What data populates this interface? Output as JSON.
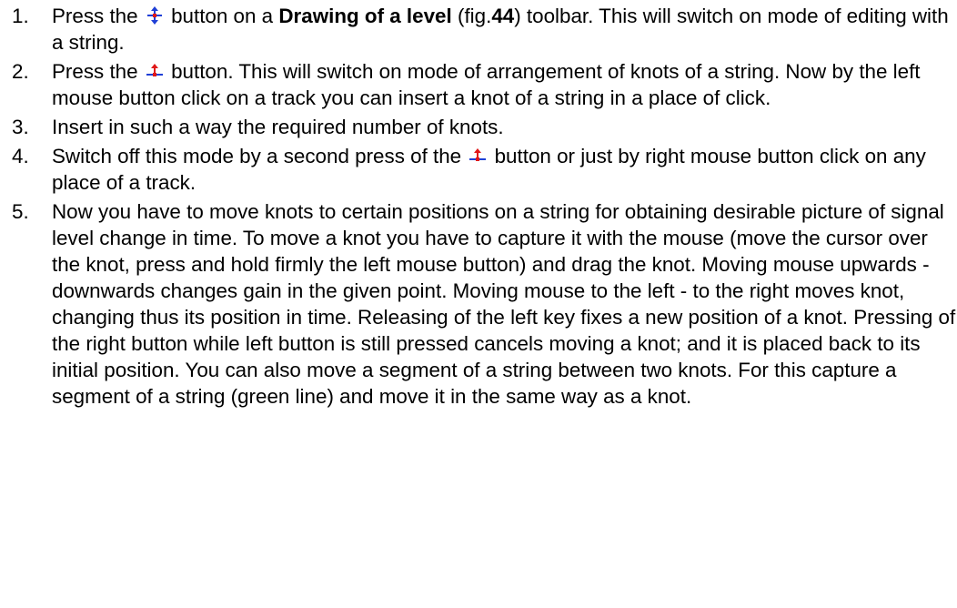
{
  "steps": [
    {
      "number": "1.",
      "before_icon": "Press the",
      "icon": "string-edit-mode-icon",
      "after_icon": "button on a",
      "bold1": "Drawing of a level",
      "mid1": "(fig.",
      "bold2": "44",
      "rest": ") toolbar. This will switch on mode of editing with a string."
    },
    {
      "number": "2.",
      "before_icon": "Press the",
      "icon": "insert-knot-icon",
      "rest": "button. This will switch on mode of arrangement of knots of a string. Now by the left mouse button click on a track you can insert a knot of a string in a place of click."
    },
    {
      "number": "3.",
      "text": "Insert in such a way the required number of knots."
    },
    {
      "number": "4.",
      "before_icon": "Switch off this mode by a second press of the",
      "icon": "insert-knot-icon",
      "rest": "button or just by right mouse button click on any place of a track."
    },
    {
      "number": "5.",
      "text": "Now you have to move knots to certain positions on a string for obtaining desirable picture of signal level change in time. To move a knot you have to capture it with the mouse (move the cursor over the knot, press and hold firmly the left mouse button) and drag the knot. Moving mouse upwards - downwards changes gain in the given point. Moving mouse to the left - to the right moves knot, changing thus its position in time. Releasing of the left key fixes a new position of a knot. Pressing of the right button while left button is still pressed cancels moving a knot; and it is placed back to its initial position. You can also move a segment of a string between two knots. For this capture a segment of a string (green line) and move it in the same way as a knot."
    }
  ],
  "colors": {
    "text": "#000000",
    "icon_blue": "#1f3fd6",
    "icon_red": "#e01818"
  }
}
